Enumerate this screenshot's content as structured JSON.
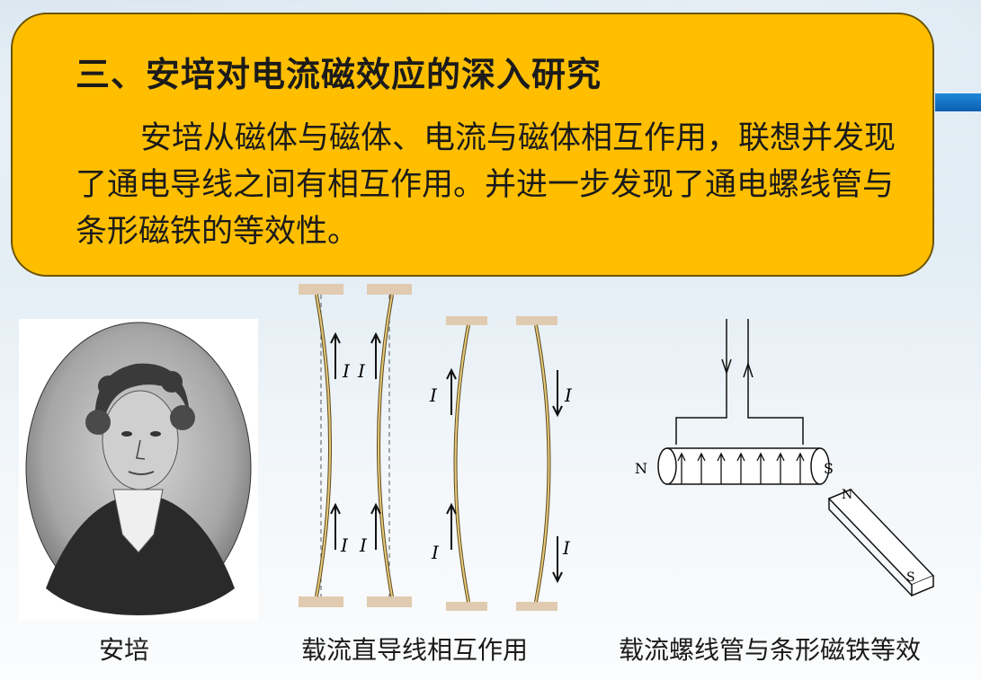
{
  "slide": {
    "title": "三、安培对电流磁效应的深入研究",
    "body": "安培从磁体与磁体、电流与磁体相互作用，联想并发现了通电导线之间有相互作用。并进一步发现了通电螺线管与条形磁铁的等效性。"
  },
  "figures": {
    "portrait_caption": "安培",
    "wires_caption": "载流直导线相互作用",
    "solenoid_caption": "载流螺线管与条形磁铁等效"
  },
  "wire_labels": {
    "current": "I",
    "north": "N",
    "south": "S"
  }
}
